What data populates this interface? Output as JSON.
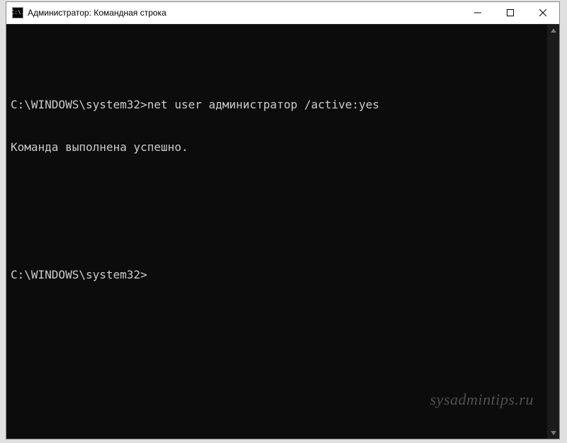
{
  "window": {
    "title": "Администратор: Командная строка",
    "icon_text": "C:\\."
  },
  "terminal": {
    "prompt": "C:\\WINDOWS\\system32>",
    "command": "net user администратор /active:yes",
    "response": "Команда выполнена успешно.",
    "line1": "C:\\WINDOWS\\system32>net user администратор /active:yes",
    "line2": "Команда выполнена успешно.",
    "line3": "C:\\WINDOWS\\system32>"
  },
  "watermark": "sysadmintips.ru"
}
